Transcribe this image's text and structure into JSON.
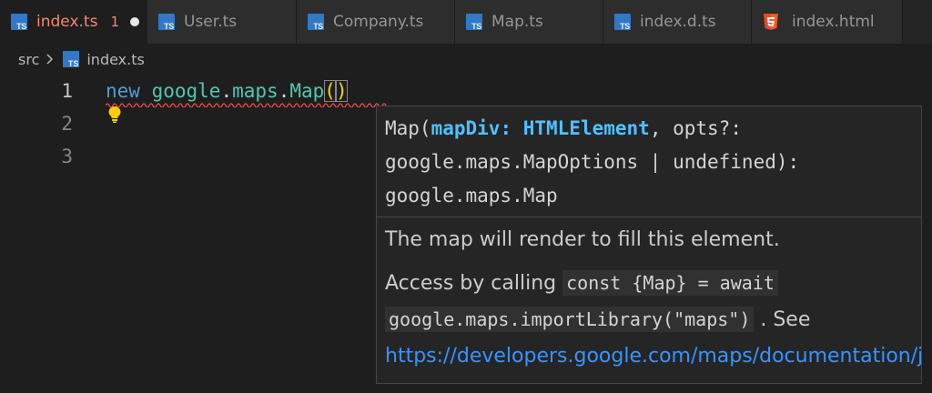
{
  "tabs": [
    {
      "label": "index.ts",
      "icon": "typescript-icon",
      "active": true,
      "problems": "1",
      "dirty": true
    },
    {
      "label": "User.ts",
      "icon": "typescript-icon"
    },
    {
      "label": "Company.ts",
      "icon": "typescript-icon"
    },
    {
      "label": "Map.ts",
      "icon": "typescript-icon"
    },
    {
      "label": "index.d.ts",
      "icon": "typescript-icon"
    },
    {
      "label": "index.html",
      "icon": "html5-icon"
    }
  ],
  "ts_badge": "TS",
  "breadcrumb": {
    "folder": "src",
    "file": "index.ts"
  },
  "editor": {
    "line_numbers": [
      "1",
      "2",
      "3"
    ],
    "code": {
      "keyword": "new",
      "ns1": "google",
      "dot": ".",
      "ns2": "maps",
      "cls": "Map",
      "open": "(",
      "close": ")"
    }
  },
  "hover": {
    "sig_1_pre": "Map(",
    "sig_1_param": "mapDiv",
    "sig_1_colon": ": ",
    "sig_1_type": "HTMLElement",
    "sig_1_post": ", opts?:",
    "sig_2": "google.maps.MapOptions | undefined):",
    "sig_3": "google.maps.Map",
    "doc_line1": "The map will render to fill this element.",
    "doc_line2_pre": "Access by calling",
    "doc_line2_code": "const {Map} = await",
    "doc_line3_code": "google.maps.importLibrary(\"maps\")",
    "doc_line3_post": ". See",
    "doc_link": "https://developers.google.com/maps/documentation/javascript/reference/map#Map"
  },
  "colors": {
    "editor_bg": "#1e1e1e",
    "keyword": "#569cd6",
    "type": "#4ec9b0",
    "error": "#f14c4c",
    "link": "#3794ff",
    "bracket": "#ffd700"
  }
}
